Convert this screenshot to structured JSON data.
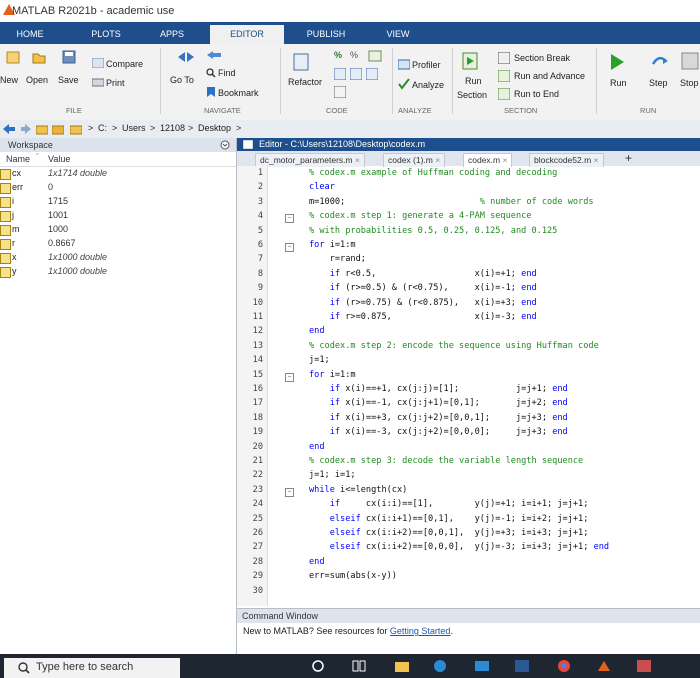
{
  "window": {
    "title": "MATLAB R2021b - academic use"
  },
  "tabs": [
    "HOME",
    "PLOTS",
    "APPS",
    "EDITOR",
    "PUBLISH",
    "VIEW"
  ],
  "ribbon": {
    "file": {
      "new": "New",
      "open": "Open",
      "save": "Save",
      "compare": "Compare",
      "print": "Print",
      "section": "FILE"
    },
    "navigate": {
      "goto": "Go To",
      "find": "Find",
      "bookmark": "Bookmark",
      "section": "NAVIGATE"
    },
    "code": {
      "refactor": "Refactor",
      "section": "CODE"
    },
    "analyze": {
      "profiler": "Profiler",
      "analyze": "Analyze",
      "section": "ANALYZE"
    },
    "section": {
      "run_section": "Run Section",
      "section_break": "Section Break",
      "run_and_advance": "Run and Advance",
      "run_to_end": "Run to End",
      "section": "SECTION"
    },
    "run": {
      "run": "Run",
      "step": "Step",
      "stop": "Stop",
      "section": "RUN"
    }
  },
  "path": {
    "sep": ">",
    "drive": "C:",
    "p1": "Users",
    "p2": "12108",
    "p3": "Desktop"
  },
  "workspace": {
    "title": "Workspace",
    "col_name": "Name",
    "col_value": "Value",
    "vars": [
      {
        "name": "cx",
        "value": "1x1714 double",
        "italic": true
      },
      {
        "name": "err",
        "value": "0",
        "italic": false
      },
      {
        "name": "i",
        "value": "1715",
        "italic": false
      },
      {
        "name": "j",
        "value": "1001",
        "italic": false
      },
      {
        "name": "m",
        "value": "1000",
        "italic": false
      },
      {
        "name": "r",
        "value": "0.8667",
        "italic": false
      },
      {
        "name": "x",
        "value": "1x1000 double",
        "italic": true
      },
      {
        "name": "y",
        "value": "1x1000 double",
        "italic": true
      }
    ]
  },
  "editor": {
    "title": "Editor - C:\\Users\\12108\\Desktop\\codex.m",
    "tabs": [
      "dc_motor_parameters.m",
      "codex (1).m",
      "codex.m",
      "blockcode52.m"
    ],
    "lines": [
      "% codex.m example of Huffman coding and decoding",
      "clear",
      "m=1000;                          % number of code words",
      "% codex.m step 1: generate a 4-PAM sequence",
      "% with probabilities 0.5, 0.25, 0.125, and 0.125",
      "for i=1:m",
      "    r=rand;",
      "    if r<0.5,                   x(i)=+1; end",
      "    if (r>=0.5) & (r<0.75),     x(i)=-1; end",
      "    if (r>=0.75) & (r<0.875),   x(i)=+3; end",
      "    if r>=0.875,                x(i)=-3; end",
      "end",
      "% codex.m step 2: encode the sequence using Huffman code",
      "j=1;",
      "for i=1:m",
      "    if x(i)==+1, cx(j:j)=[1];           j=j+1; end",
      "    if x(i)==-1, cx(j:j+1)=[0,1];       j=j+2; end",
      "    if x(i)==+3, cx(j:j+2)=[0,0,1];     j=j+3; end",
      "    if x(i)==-3, cx(j:j+2)=[0,0,0];     j=j+3; end",
      "end",
      "% codex.m step 3: decode the variable length sequence",
      "j=1; i=1;",
      "while i<=length(cx)",
      "    if     cx(i:i)==[1],        y(j)=+1; i=i+1; j=j+1;",
      "    elseif cx(i:i+1)==[0,1],    y(j)=-1; i=i+2; j=j+1;",
      "    elseif cx(i:i+2)==[0,0,1],  y(j)=+3; i=i+3; j=j+1;",
      "    elseif cx(i:i+2)==[0,0,0],  y(j)=-3; i=i+3; j=j+1; end",
      "end",
      "err=sum(abs(x-y))",
      ""
    ]
  },
  "command_window": {
    "title": "Command Window",
    "message": "New to MATLAB? See resources for ",
    "link": "Getting Started",
    "after": "."
  },
  "taskbar": {
    "search_placeholder": "Type here to search"
  }
}
